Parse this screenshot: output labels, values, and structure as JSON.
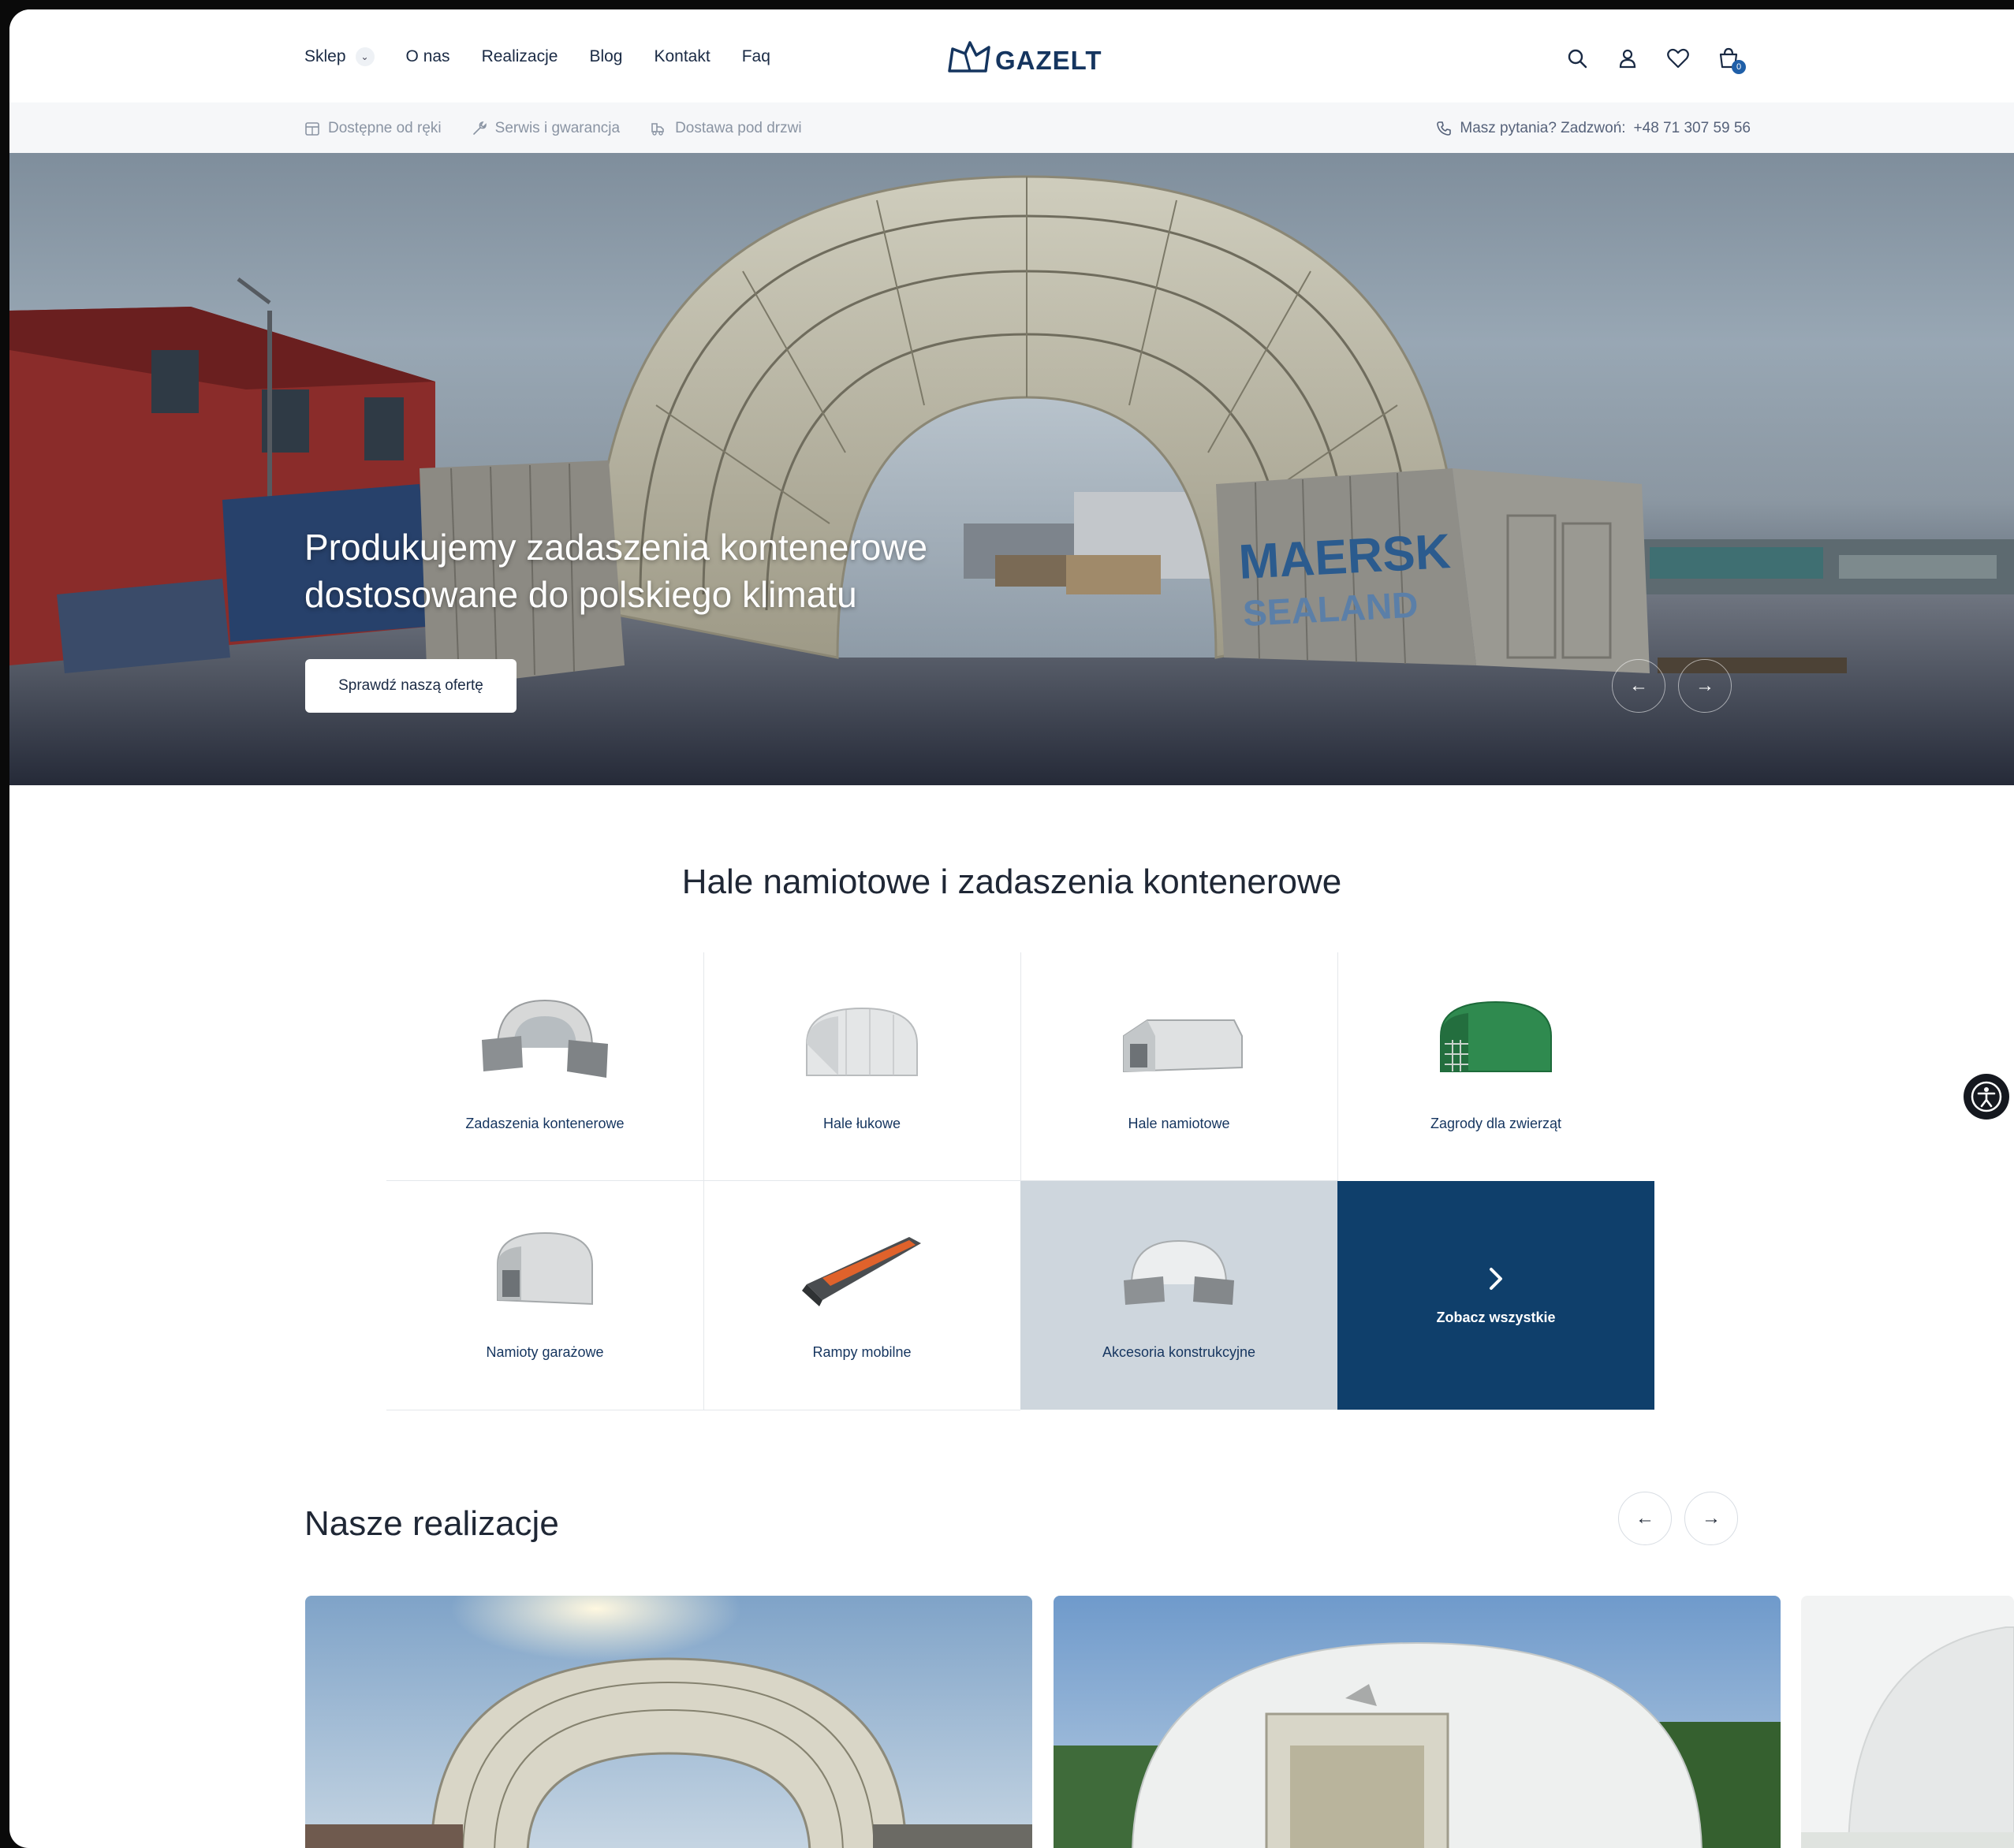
{
  "header": {
    "nav": [
      {
        "label": "Sklep",
        "dropdown": true
      },
      {
        "label": "O nas"
      },
      {
        "label": "Realizacje"
      },
      {
        "label": "Blog"
      },
      {
        "label": "Kontakt"
      },
      {
        "label": "Faq"
      }
    ],
    "logo_text": "GAZELT",
    "cart_count": "0",
    "icons": [
      "search-icon",
      "user-icon",
      "heart-icon",
      "cart-icon"
    ]
  },
  "infobar": {
    "items": [
      {
        "icon": "calendar-icon",
        "label": "Dostępne od ręki"
      },
      {
        "icon": "wrench-icon",
        "label": "Serwis i gwarancja"
      },
      {
        "icon": "truck-icon",
        "label": "Dostawa pod drzwi"
      }
    ],
    "contact_label": "Masz pytania? Zadzwoń: ",
    "contact_phone": "+48 71 307 59 56"
  },
  "hero": {
    "title_line1": "Produkujemy zadaszenia kontenerowe",
    "title_line2": "dostosowane do polskiego klimatu",
    "cta": "Sprawdź naszą ofertę",
    "container_brand": "MAERSK",
    "container_sub": "SEALAND"
  },
  "categories": {
    "title": "Hale namiotowe i zadaszenia kontenerowe",
    "items": [
      {
        "label": "Zadaszenia kontenerowe"
      },
      {
        "label": "Hale łukowe"
      },
      {
        "label": "Hale namiotowe"
      },
      {
        "label": "Zagrody dla zwierząt"
      },
      {
        "label": "Namioty garażowe"
      },
      {
        "label": "Rampy mobilne"
      },
      {
        "label": "Akcesoria konstrukcyjne"
      }
    ],
    "see_all": "Zobacz wszystkie"
  },
  "realizacje": {
    "title": "Nasze realizacje"
  },
  "colors": {
    "brand_navy": "#0f3f6b",
    "text_dark": "#1f2735",
    "accent_blue": "#1f5fa8",
    "highlight_gray": "#ced6dd"
  }
}
